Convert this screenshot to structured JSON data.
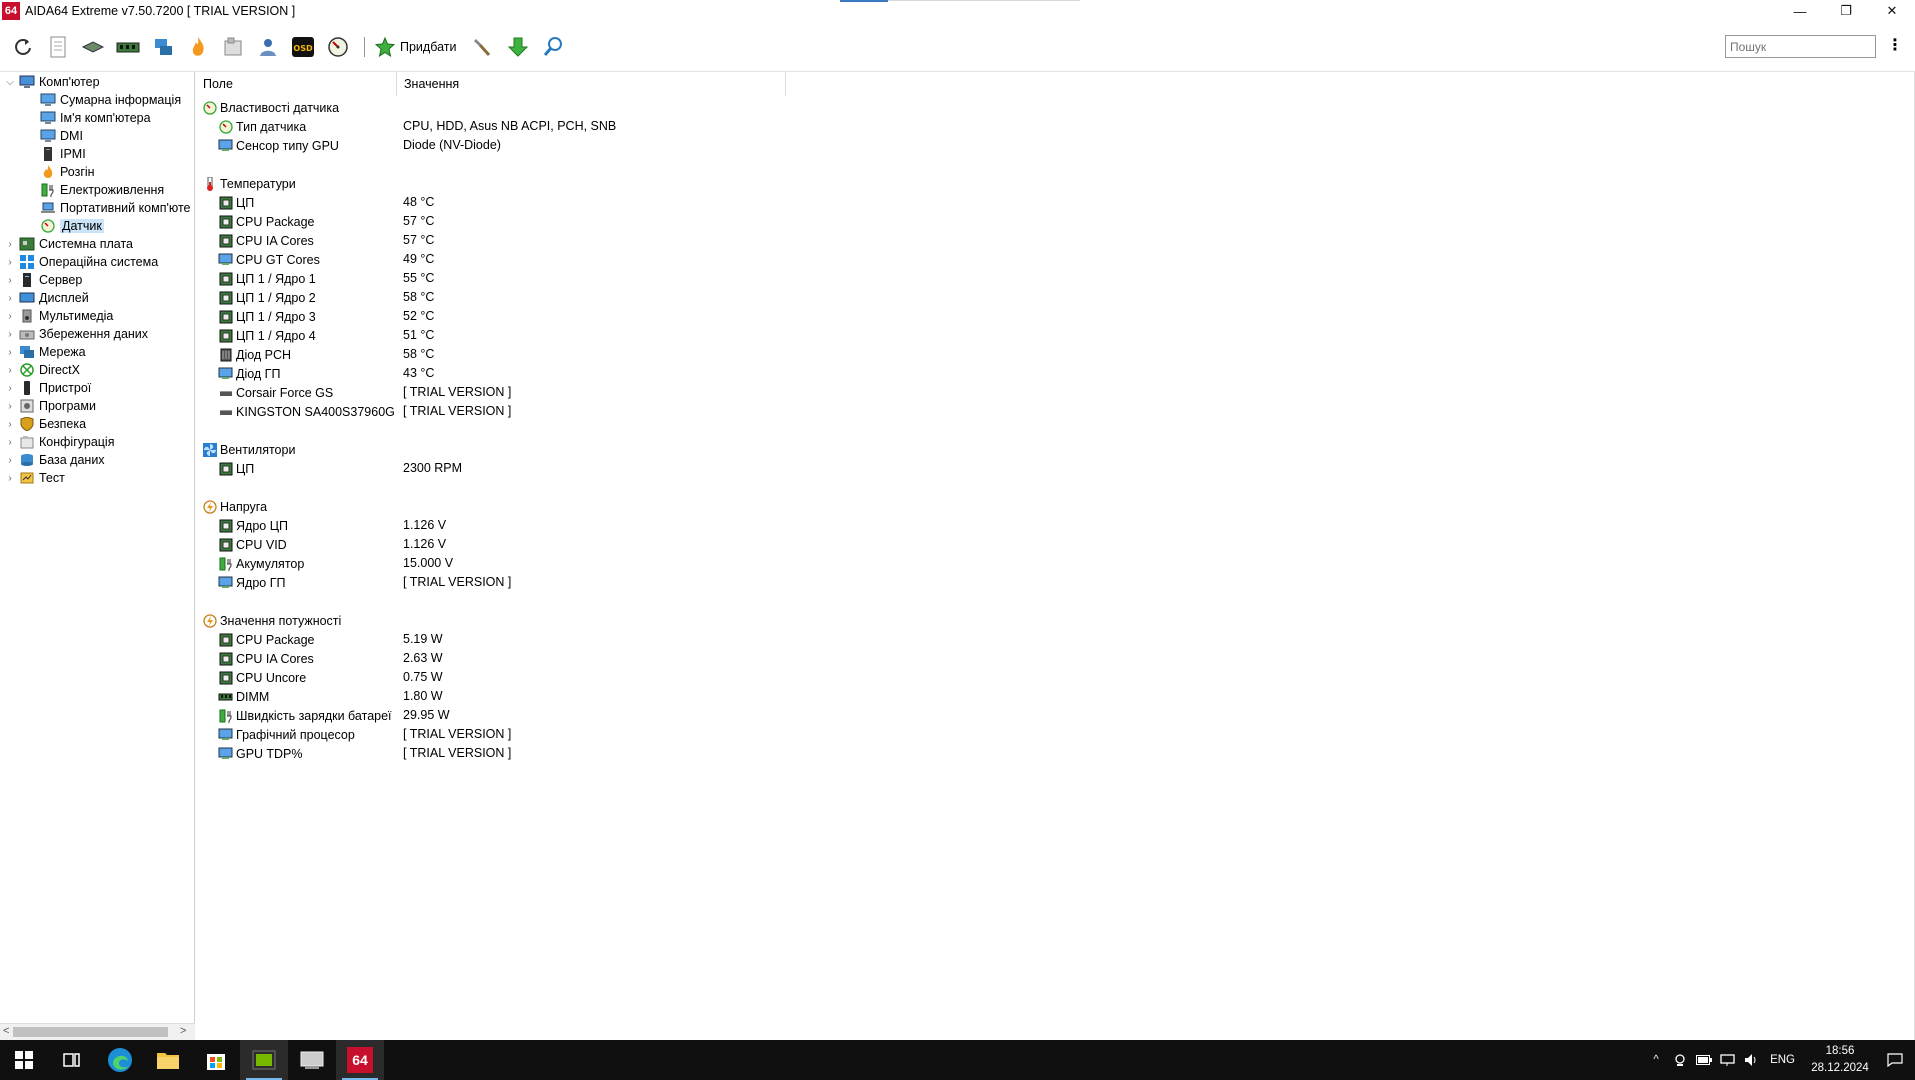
{
  "window": {
    "logo": "64",
    "title": "AIDA64 Extreme v7.50.7200  [ TRIAL VERSION ]",
    "minimize": "—",
    "restore": "❐",
    "close": "✕"
  },
  "toolbar": {
    "add_label": "Придбати",
    "search_placeholder": "Пошук",
    "more": "⋮"
  },
  "tree": {
    "items": [
      {
        "label": "Комп'ютер",
        "level": 0,
        "expanded": true,
        "icon": "computer-icon"
      },
      {
        "label": "Сумарна інформація",
        "level": 1,
        "icon": "monitor-icon"
      },
      {
        "label": "Ім'я комп'ютера",
        "level": 1,
        "icon": "monitor-icon"
      },
      {
        "label": "DMI",
        "level": 1,
        "icon": "monitor-icon"
      },
      {
        "label": "IPMI",
        "level": 1,
        "icon": "tower-icon"
      },
      {
        "label": "Розгін",
        "level": 1,
        "icon": "flame-icon"
      },
      {
        "label": "Електроживлення",
        "level": 1,
        "icon": "battery-icon"
      },
      {
        "label": "Портативний комп'юте",
        "level": 1,
        "icon": "laptop-icon"
      },
      {
        "label": "Датчик",
        "level": 1,
        "icon": "gauge-icon",
        "selected": true
      },
      {
        "label": "Системна плата",
        "level": 0,
        "icon": "motherboard-icon"
      },
      {
        "label": "Операційна система",
        "level": 0,
        "icon": "windows-icon"
      },
      {
        "label": "Сервер",
        "level": 0,
        "icon": "server-icon"
      },
      {
        "label": "Дисплей",
        "level": 0,
        "icon": "display-icon"
      },
      {
        "label": "Мультимедіа",
        "level": 0,
        "icon": "speaker-icon"
      },
      {
        "label": "Збереження даних",
        "level": 0,
        "icon": "storage-icon"
      },
      {
        "label": "Мережа",
        "level": 0,
        "icon": "network-icon"
      },
      {
        "label": "DirectX",
        "level": 0,
        "icon": "directx-icon"
      },
      {
        "label": "Пристрої",
        "level": 0,
        "icon": "device-icon"
      },
      {
        "label": "Програми",
        "level": 0,
        "icon": "programs-icon"
      },
      {
        "label": "Безпека",
        "level": 0,
        "icon": "shield-icon"
      },
      {
        "label": "Конфігурація",
        "level": 0,
        "icon": "config-icon"
      },
      {
        "label": "База даних",
        "level": 0,
        "icon": "database-icon"
      },
      {
        "label": "Тест",
        "level": 0,
        "icon": "test-icon"
      }
    ]
  },
  "list": {
    "col_field": "Поле",
    "col_value": "Значення",
    "groups": [
      {
        "title": "Властивості датчика",
        "icon": "gauge-icon",
        "rows": [
          {
            "field": "Тип датчика",
            "value": "CPU, HDD, Asus NB ACPI, PCH, SNB",
            "icon": "gauge-icon"
          },
          {
            "field": "Сенсор типу GPU",
            "value": "Diode  (NV-Diode)",
            "icon": "gpu-icon"
          }
        ]
      },
      {
        "title": "Температури",
        "icon": "thermometer-icon",
        "rows": [
          {
            "field": "ЦП",
            "value": "48 °C",
            "icon": "cpu-icon"
          },
          {
            "field": "CPU Package",
            "value": "57 °C",
            "icon": "cpu-icon"
          },
          {
            "field": "CPU IA Cores",
            "value": "57 °C",
            "icon": "cpu-icon"
          },
          {
            "field": "CPU GT Cores",
            "value": "49 °C",
            "icon": "gpu-icon"
          },
          {
            "field": "ЦП 1 / Ядро 1",
            "value": "55 °C",
            "icon": "cpu-icon"
          },
          {
            "field": "ЦП 1 / Ядро 2",
            "value": "58 °C",
            "icon": "cpu-icon"
          },
          {
            "field": "ЦП 1 / Ядро 3",
            "value": "52 °C",
            "icon": "cpu-icon"
          },
          {
            "field": "ЦП 1 / Ядро 4",
            "value": "51 °C",
            "icon": "cpu-icon"
          },
          {
            "field": "Діод PCH",
            "value": "58 °C",
            "icon": "chip-icon"
          },
          {
            "field": "Діод ГП",
            "value": "43 °C",
            "icon": "gpu-icon"
          },
          {
            "field": "Corsair Force GS",
            "value": "[ TRIAL VERSION ]",
            "icon": "drive-icon"
          },
          {
            "field": "KINGSTON SA400S37960G",
            "value": "[ TRIAL VERSION ]",
            "icon": "drive-icon"
          }
        ]
      },
      {
        "title": "Вентилятори",
        "icon": "fan-icon",
        "rows": [
          {
            "field": "ЦП",
            "value": "2300 RPM",
            "icon": "cpu-icon"
          }
        ]
      },
      {
        "title": "Напруга",
        "icon": "voltage-icon",
        "rows": [
          {
            "field": "Ядро ЦП",
            "value": "1.126 V",
            "icon": "cpu-icon"
          },
          {
            "field": "CPU VID",
            "value": "1.126 V",
            "icon": "cpu-icon"
          },
          {
            "field": "Акумулятор",
            "value": "15.000 V",
            "icon": "battery-icon"
          },
          {
            "field": "Ядро ГП",
            "value": "[ TRIAL VERSION ]",
            "icon": "gpu-icon"
          }
        ]
      },
      {
        "title": "Значення потужності",
        "icon": "power-icon",
        "rows": [
          {
            "field": "CPU Package",
            "value": "5.19 W",
            "icon": "cpu-icon"
          },
          {
            "field": "CPU IA Cores",
            "value": "2.63 W",
            "icon": "cpu-icon"
          },
          {
            "field": "CPU Uncore",
            "value": "0.75 W",
            "icon": "cpu-icon"
          },
          {
            "field": "DIMM",
            "value": "1.80 W",
            "icon": "ram-icon"
          },
          {
            "field": "Швидкість зарядки батареї",
            "value": "29.95 W",
            "icon": "battery-icon"
          },
          {
            "field": "Графічний процесор",
            "value": "[ TRIAL VERSION ]",
            "icon": "gpu-icon"
          },
          {
            "field": "GPU TDP%",
            "value": "[ TRIAL VERSION ]",
            "icon": "gpu-icon"
          }
        ]
      }
    ]
  },
  "taskbar": {
    "active_app_label": "64",
    "lang": "ENG",
    "time": "18:56",
    "date": "28.12.2024"
  },
  "colors": {
    "aida_red": "#c8102e",
    "selection": "#cce4f7",
    "taskbar_bg": "#101010"
  }
}
